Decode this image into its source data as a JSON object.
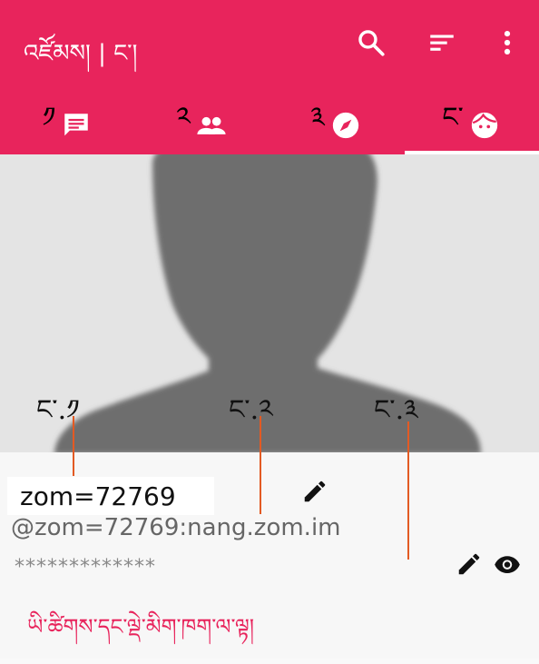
{
  "appbar": {
    "title": "འཛོམས། | ང་།",
    "background": "#e8245c",
    "actions": [
      {
        "name": "search-icon"
      },
      {
        "name": "sort-icon"
      },
      {
        "name": "more-vert-icon"
      }
    ]
  },
  "tabs": [
    {
      "label": "༡",
      "icon": "chat-icon"
    },
    {
      "label": "༢",
      "icon": "contacts-icon"
    },
    {
      "label": "༣",
      "icon": "compass-icon"
    },
    {
      "label": "ང་",
      "icon": "face-icon",
      "selected": true
    }
  ],
  "annotations": [
    {
      "label": "ང་.༡",
      "target": "name"
    },
    {
      "label": "ང་.༢",
      "target": "user id"
    },
    {
      "label": "ང་.༣",
      "target": "password"
    }
  ],
  "profile": {
    "name": "zom=72769",
    "user_id": "@zom=72769:nang.zom.im",
    "password_masked": "*************",
    "forgot_password": "ཡི་ཚིགས་དང་ལྡེ་མིག་ཁག་ལ་ལྟ།"
  }
}
